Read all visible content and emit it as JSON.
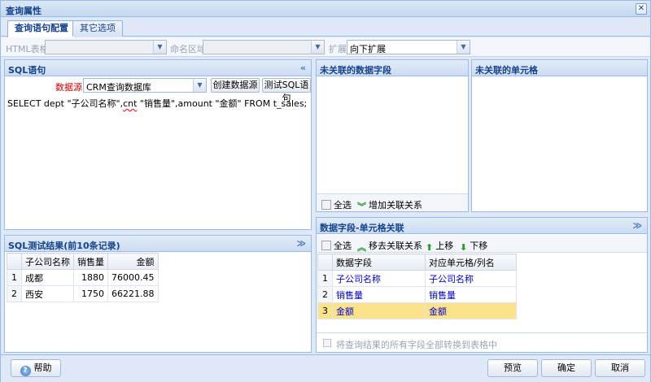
{
  "window": {
    "title": "查询属性",
    "close_glyph": "✕"
  },
  "tabs": [
    {
      "label": "查询语句配置",
      "active": true
    },
    {
      "label": "其它选项",
      "active": false
    }
  ],
  "form": {
    "html_table_label": "HTML表格",
    "html_table_value": "",
    "named_area_label": "命名区域",
    "named_area_value": "",
    "expand_label": "扩展",
    "expand_value": "向下扩展"
  },
  "sql_panel": {
    "title": "SQL语句",
    "collapse_glyph": "«",
    "datasource_label": "数据源",
    "datasource_value": "CRM查询数据库",
    "create_button": "创建数据源",
    "test_button": "测试SQL语句",
    "sql_parts": {
      "p1": "SELECT dept \"子公司名称\",",
      "p2": "cnt",
      "p3": " \"销售量\",amount \"金额\" FROM t_sales;"
    }
  },
  "result_panel": {
    "title": "SQL测试结果(前10条记录)",
    "collapse_glyph": "≫",
    "columns": [
      "子公司名称",
      "销售量",
      "金额"
    ],
    "rows": [
      {
        "n": "1",
        "name": "成都",
        "qty": "1880",
        "amount": "76000.45"
      },
      {
        "n": "2",
        "name": "西安",
        "qty": "1750",
        "amount": "66221.88"
      }
    ]
  },
  "unlinked_fields": {
    "title": "未关联的数据字段",
    "select_all": "全选",
    "add_link": "增加关联关系"
  },
  "unlinked_cells": {
    "title": "未关联的单元格"
  },
  "mapping_panel": {
    "title": "数据字段-单元格关联",
    "collapse_glyph": "≫",
    "select_all": "全选",
    "remove_link": "移去关联关系",
    "move_up": "上移",
    "move_down": "下移",
    "columns": [
      "数据字段",
      "对应单元格/列名"
    ],
    "rows": [
      {
        "n": "1",
        "field": "子公司名称",
        "cell": "子公司名称",
        "selected": false
      },
      {
        "n": "2",
        "field": "销售量",
        "cell": "销售量",
        "selected": false
      },
      {
        "n": "3",
        "field": "金额",
        "cell": "金额",
        "selected": true
      }
    ],
    "convert_checkbox_label": "将查询结果的所有字段全部转换到表格中"
  },
  "footer": {
    "help": "帮助",
    "preview": "预览",
    "ok": "确定",
    "cancel": "取消"
  }
}
